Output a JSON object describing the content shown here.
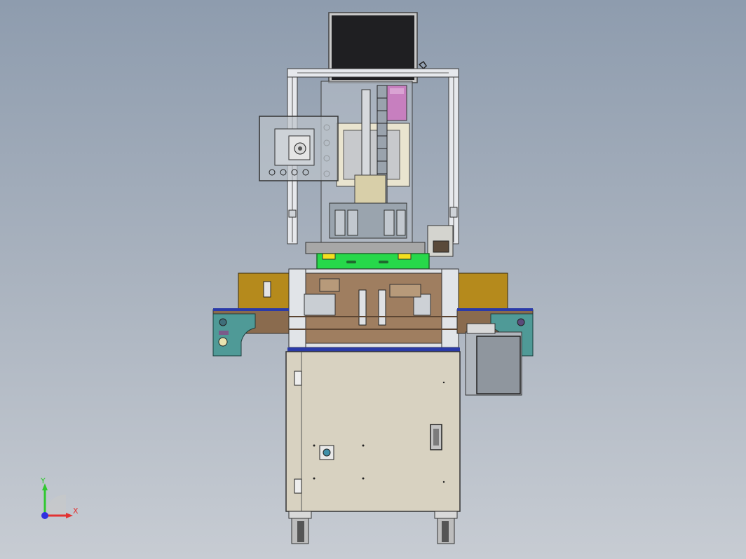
{
  "scene": {
    "background_top": "#8e9cae",
    "background_bottom": "#c7ccd3",
    "cabinet_color": "#d8d2c1",
    "conveyor_brown": "#8a6b4e",
    "accent_green": "#27d84a",
    "accent_yellow": "#f3e01e",
    "teal_housing": "#4f9a97",
    "gold_side": "#b58a1c",
    "monitor_color": "#1f1f22"
  },
  "axis_triad": {
    "x_label": "X",
    "y_label": "Y",
    "x_color": "#e23232",
    "y_color": "#30c830",
    "z_color": "#3030e0"
  },
  "icons": [
    "triad-icon",
    "caster-wheel-icon",
    "cabinet-handle-icon",
    "hinge-icon",
    "lock-icon"
  ]
}
